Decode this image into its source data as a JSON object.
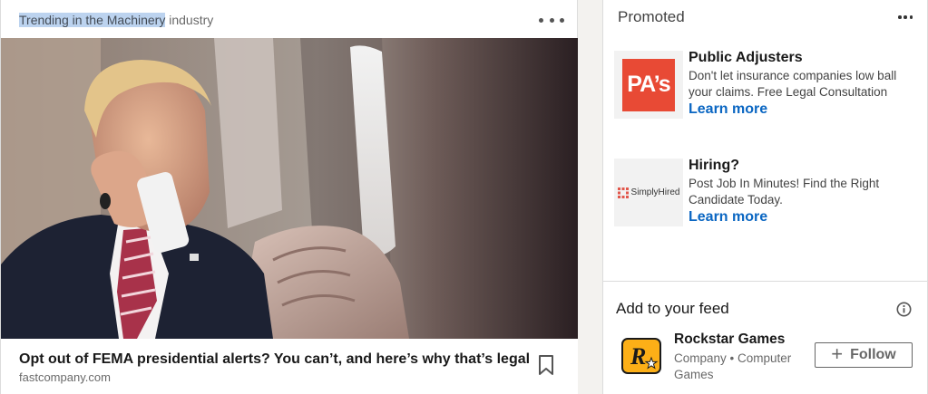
{
  "feed": {
    "trending_highlight": "Trending in the Machinery",
    "trending_rest": " industry",
    "article": {
      "title": "Opt out of FEMA presidential alerts? You can’t, and here’s why that’s legal",
      "source": "fastcompany.com"
    },
    "icons": {
      "more": "more-horizontal-icon",
      "bookmark": "bookmark-icon"
    }
  },
  "promoted": {
    "title": "Promoted",
    "ads": [
      {
        "name": "Public Adjusters",
        "logo_text": "PA’s",
        "description": "Don't let insurance companies low ball your claims. Free Legal Consultation",
        "cta": "Learn more"
      },
      {
        "name": "Hiring?",
        "logo_text": "SimplyHired",
        "description": "Post Job In Minutes! Find the Right Candidate Today.",
        "cta": "Learn more"
      }
    ]
  },
  "add_to_feed": {
    "title": "Add to your feed",
    "suggestion": {
      "name": "Rockstar Games",
      "subtitle": "Company • Computer Games",
      "logo_text": "R",
      "button": "Follow"
    }
  },
  "colors": {
    "link": "#0a66c2",
    "highlight": "#bcd3ef",
    "pa_brand": "#e84a35",
    "rockstar_yellow": "#fcaf17"
  }
}
